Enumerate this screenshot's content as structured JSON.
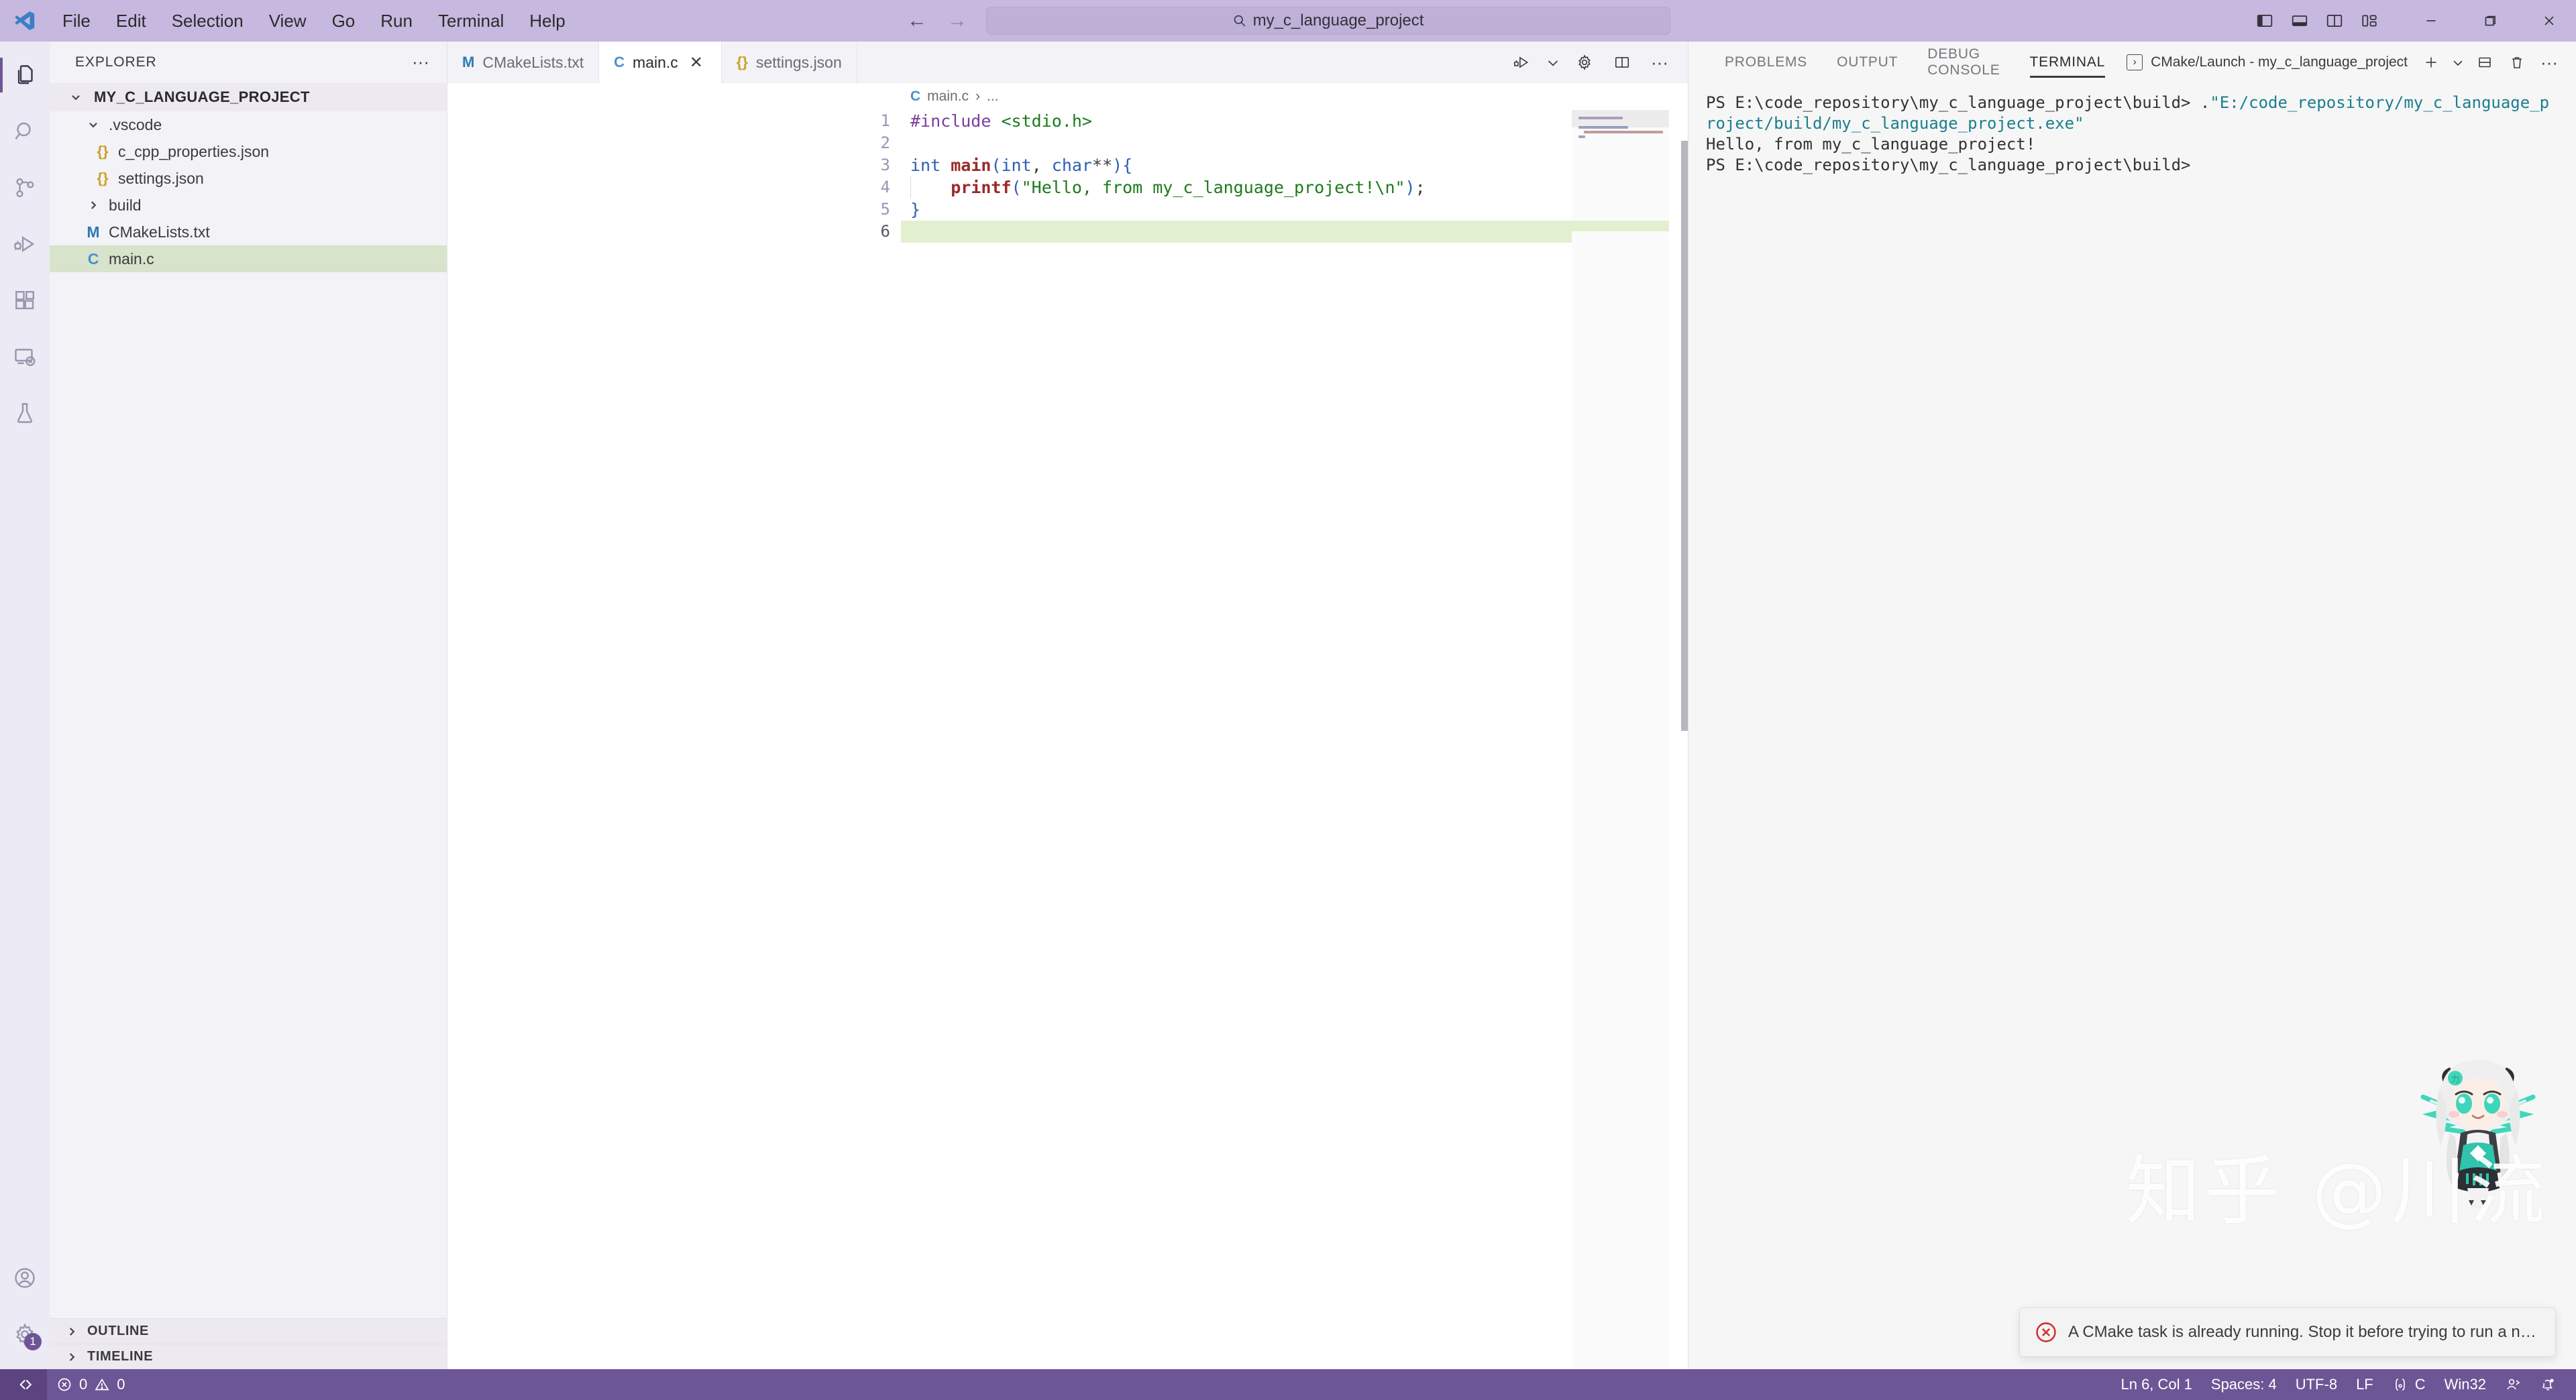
{
  "titlebar": {
    "logo_icon": "vscode-logo-icon",
    "menu": [
      "File",
      "Edit",
      "Selection",
      "View",
      "Go",
      "Run",
      "Terminal",
      "Help"
    ],
    "nav_back_icon": "arrow-left-icon",
    "nav_forward_icon": "arrow-right-icon",
    "command_center": {
      "search_icon": "search-icon",
      "text": "my_c_language_project"
    },
    "window_controls": [
      {
        "name": "toggle-primary-sidebar-icon",
        "title": "Toggle Primary Side Bar"
      },
      {
        "name": "toggle-panel-icon",
        "title": "Toggle Panel"
      },
      {
        "name": "toggle-secondary-sidebar-icon",
        "title": "Toggle Secondary Side Bar"
      },
      {
        "name": "customize-layout-icon",
        "title": "Customize Layout"
      },
      {
        "name": "minimize-icon",
        "title": "Minimize"
      },
      {
        "name": "maximize-icon",
        "title": "Restore"
      },
      {
        "name": "close-window-icon",
        "title": "Close"
      }
    ]
  },
  "activitybar": {
    "items": [
      {
        "name": "explorer",
        "icon": "files-icon",
        "active": true
      },
      {
        "name": "search",
        "icon": "search-icon",
        "active": false
      },
      {
        "name": "source-control",
        "icon": "source-control-icon",
        "active": false
      },
      {
        "name": "run-and-debug",
        "icon": "run-debug-icon",
        "active": false
      },
      {
        "name": "extensions",
        "icon": "extensions-icon",
        "active": false
      },
      {
        "name": "remote-explorer",
        "icon": "remote-explorer-icon",
        "active": false
      },
      {
        "name": "testing",
        "icon": "testing-flask-icon",
        "active": false
      }
    ],
    "account_icon": "account-icon",
    "settings_icon": "gear-icon",
    "settings_badge": "1"
  },
  "sidebar": {
    "title": "EXPLORER",
    "more_actions": "···",
    "root": "MY_C_LANGUAGE_PROJECT",
    "tree": [
      {
        "label": ".vscode",
        "type": "folder",
        "expanded": true,
        "indent": 1,
        "icon": "chevron-down-icon"
      },
      {
        "label": "c_cpp_properties.json",
        "type": "json",
        "indent": 2,
        "icon": "json-file-icon"
      },
      {
        "label": "settings.json",
        "type": "json",
        "indent": 2,
        "icon": "json-file-icon"
      },
      {
        "label": "build",
        "type": "folder",
        "expanded": false,
        "indent": 1,
        "icon": "chevron-right-icon"
      },
      {
        "label": "CMakeLists.txt",
        "type": "cmake",
        "indent": 1,
        "icon": "cmake-file-icon"
      },
      {
        "label": "main.c",
        "type": "c",
        "indent": 1,
        "icon": "c-file-icon",
        "selected": true
      }
    ],
    "sections": [
      "OUTLINE",
      "TIMELINE"
    ]
  },
  "editor": {
    "tabs": [
      {
        "label": "CMakeLists.txt",
        "icon": "M",
        "icon_name": "cmake-file-icon",
        "active": false,
        "closable": false
      },
      {
        "label": "main.c",
        "icon": "C",
        "icon_name": "c-file-icon",
        "active": true,
        "closable": true,
        "close": "✕"
      },
      {
        "label": "settings.json",
        "icon": "{}",
        "icon_name": "json-file-icon",
        "active": false,
        "closable": false
      }
    ],
    "actions": [
      {
        "name": "run-or-debug-icon",
        "title": "Run or Debug"
      },
      {
        "name": "chevron-down-icon",
        "title": "More Run Options"
      },
      {
        "name": "gear-icon",
        "title": "C/C++ Configurations"
      },
      {
        "name": "split-editor-icon",
        "title": "Split Editor"
      },
      {
        "name": "more-actions-icon",
        "title": "More Actions",
        "glyph": "···"
      }
    ],
    "breadcrumb": {
      "icon": "C",
      "file": "main.c",
      "separator": "›",
      "rest": "..."
    },
    "lines": [
      {
        "n": "1",
        "tokens": [
          {
            "t": "#include ",
            "c": "k-pre"
          },
          {
            "t": "<stdio.h>",
            "c": "k-str"
          }
        ]
      },
      {
        "n": "2",
        "tokens": []
      },
      {
        "n": "3",
        "tokens": [
          {
            "t": "int ",
            "c": "k-type"
          },
          {
            "t": "main",
            "c": "k-fn"
          },
          {
            "t": "(",
            "c": "k-brace"
          },
          {
            "t": "int",
            "c": "k-type"
          },
          {
            "t": ", ",
            "c": "k-punc"
          },
          {
            "t": "char",
            "c": "k-type"
          },
          {
            "t": "**",
            "c": "k-pl"
          },
          {
            "t": ")",
            "c": "k-brace"
          },
          {
            "t": "{",
            "c": "k-brace"
          }
        ]
      },
      {
        "n": "4",
        "indent": true,
        "tokens": [
          {
            "t": "    ",
            "c": "k-pl"
          },
          {
            "t": "printf",
            "c": "k-fn"
          },
          {
            "t": "(",
            "c": "k-brace"
          },
          {
            "t": "\"Hello, from my_c_language_project!\\n\"",
            "c": "k-str"
          },
          {
            "t": ")",
            "c": "k-brace"
          },
          {
            "t": ";",
            "c": "k-punc"
          }
        ]
      },
      {
        "n": "5",
        "tokens": [
          {
            "t": "}",
            "c": "k-brace"
          }
        ]
      },
      {
        "n": "6",
        "current": true,
        "tokens": []
      }
    ]
  },
  "panel": {
    "tabs": [
      {
        "label": "PROBLEMS",
        "active": false
      },
      {
        "label": "OUTPUT",
        "active": false
      },
      {
        "label": "DEBUG CONSOLE",
        "active": false
      },
      {
        "label": "TERMINAL",
        "active": true
      }
    ],
    "terminal_tab": {
      "icon": "powershell-prompt-icon",
      "glyph": "›",
      "label": "CMake/Launch - my_c_language_project"
    },
    "actions": [
      {
        "name": "new-terminal-icon",
        "glyph": "+"
      },
      {
        "name": "chevron-down-icon",
        "glyph": "⌄"
      },
      {
        "name": "split-terminal-icon"
      },
      {
        "name": "kill-terminal-icon"
      },
      {
        "name": "more-actions-icon",
        "glyph": "···"
      },
      {
        "name": "chevron-left-icon",
        "glyph": "‹"
      },
      {
        "name": "close-panel-icon",
        "glyph": "✕"
      }
    ],
    "terminal_output": [
      {
        "parts": [
          {
            "t": "PS E:\\code_repository\\my_c_language_project\\build> .",
            "c": ""
          },
          {
            "t": "\"E:/code_repository/my_c_language_project/build/my_c_language_project.exe\"",
            "c": "t-path"
          }
        ]
      },
      {
        "parts": [
          {
            "t": "Hello, from my_c_language_project!",
            "c": ""
          }
        ]
      },
      {
        "parts": [
          {
            "t": "PS E:\\code_repository\\my_c_language_project\\build>",
            "c": ""
          }
        ]
      }
    ]
  },
  "notification": {
    "icon": "error-circle-icon",
    "message": "A CMake task is already running. Stop it before trying to run a new CM..."
  },
  "watermark": {
    "text": "知乎 @川流"
  },
  "statusbar": {
    "remote_icon": "remote-window-icon",
    "errors_icon": "error-icon",
    "errors": "0",
    "warnings_icon": "warning-icon",
    "warnings": "0",
    "right_items": [
      {
        "name": "cursor-position",
        "label": "Ln 6, Col 1"
      },
      {
        "name": "indentation",
        "label": "Spaces: 4"
      },
      {
        "name": "encoding",
        "label": "UTF-8"
      },
      {
        "name": "eol",
        "label": "LF"
      },
      {
        "name": "language-mode",
        "label": "C",
        "icon": "c-lang-icon"
      },
      {
        "name": "platform",
        "label": "Win32"
      }
    ],
    "live_share_icon": "live-share-icon",
    "bell_icon": "bell-dot-icon"
  },
  "colors": {
    "titlebar_bg": "#c6b8de",
    "statusbar_bg": "#6d5696",
    "remote_bg": "#5b4480",
    "selection_green": "#d7e3cb",
    "current_line": "#e3f0cf",
    "accent": "#6d5696",
    "error_red": "#d32f2f",
    "terminal_path": "#1a7f8e"
  }
}
